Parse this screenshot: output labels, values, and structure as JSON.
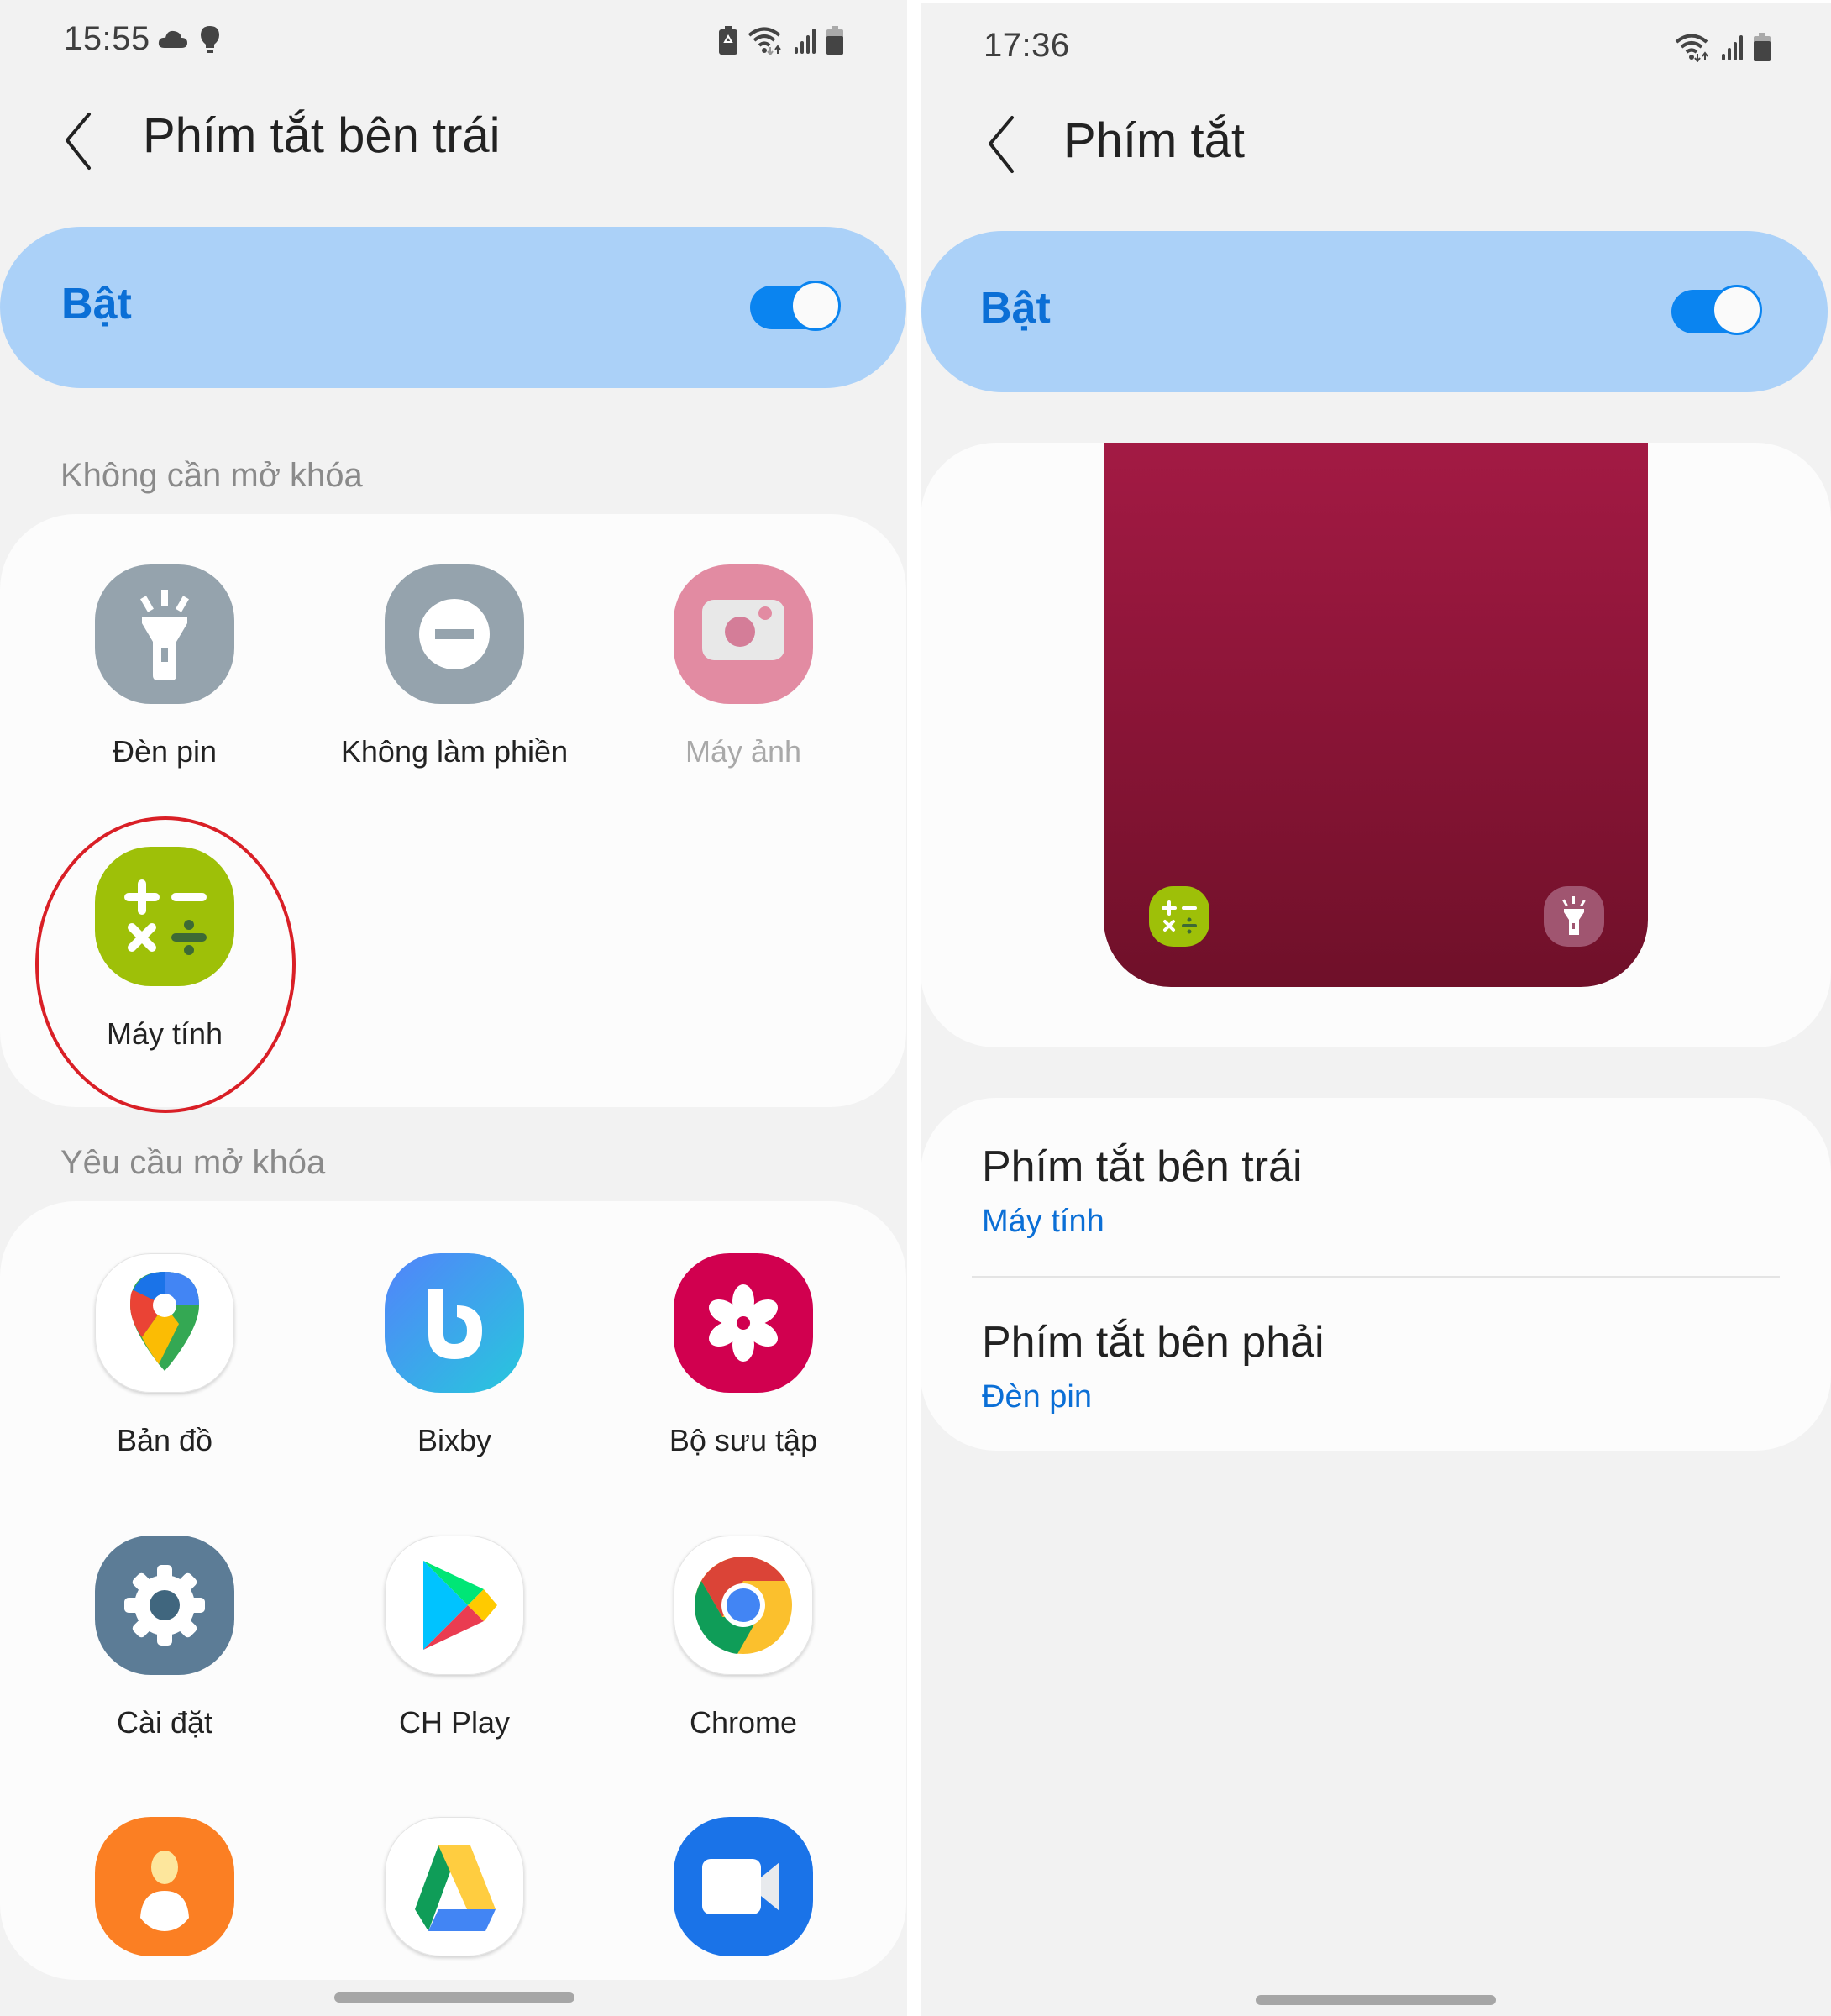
{
  "left_screen": {
    "status_bar": {
      "time": "15:55",
      "left_icons": [
        "cloud-icon",
        "lightbulb-icon"
      ],
      "right_icons": [
        "battery-saver-icon",
        "wifi-icon",
        "signal-icon",
        "battery-icon"
      ]
    },
    "header": {
      "back_icon": "back-arrow-icon",
      "title": "Phím tắt bên trái"
    },
    "master_switch": {
      "label": "Bật",
      "enabled": true
    },
    "sections": [
      {
        "label": "Không cần mở khóa",
        "apps": [
          {
            "name": "Đèn pin",
            "icon": "flashlight-icon",
            "color": "#95a3ad",
            "disabled": false
          },
          {
            "name": "Không làm phiền",
            "icon": "do-not-disturb-icon",
            "color": "#95a3ad",
            "disabled": false
          },
          {
            "name": "Máy ảnh",
            "icon": "camera-icon",
            "color": "#e28ba2",
            "disabled": true
          },
          {
            "name": "Máy tính",
            "icon": "calculator-icon",
            "color": "#9ec008",
            "disabled": false,
            "selected": true
          }
        ]
      },
      {
        "label": "Yêu cầu mở khóa",
        "apps": [
          {
            "name": "Bản đồ",
            "icon": "google-maps-icon"
          },
          {
            "name": "Bixby",
            "icon": "bixby-icon",
            "color": "#4a8cf5"
          },
          {
            "name": "Bộ sưu tập",
            "icon": "gallery-icon",
            "color": "#d1004f"
          },
          {
            "name": "Cài đặt",
            "icon": "settings-icon",
            "color": "#5c7c96"
          },
          {
            "name": "CH Play",
            "icon": "play-store-icon"
          },
          {
            "name": "Chrome",
            "icon": "chrome-icon"
          },
          {
            "name": "",
            "icon": "contacts-icon",
            "color": "#fb7f23"
          },
          {
            "name": "",
            "icon": "google-drive-icon"
          },
          {
            "name": "",
            "icon": "duo-video-icon",
            "color": "#1a73e8"
          }
        ]
      }
    ],
    "annotation": {
      "type": "red-ellipse",
      "target": "Máy tính",
      "color": "#d91f26"
    }
  },
  "right_screen": {
    "status_bar": {
      "time": "17:36",
      "right_icons": [
        "wifi-icon",
        "signal-icon",
        "battery-icon"
      ]
    },
    "header": {
      "back_icon": "back-arrow-icon",
      "title": "Phím tắt"
    },
    "master_switch": {
      "label": "Bật",
      "enabled": true
    },
    "preview": {
      "left_shortcut_icon": "calculator-icon",
      "right_shortcut_icon": "flashlight-icon",
      "wallpaper_colors": [
        "#a31a44",
        "#6f1029"
      ]
    },
    "shortcuts": [
      {
        "title": "Phím tắt bên trái",
        "value": "Máy tính"
      },
      {
        "title": "Phím tắt bên phải",
        "value": "Đèn pin"
      }
    ]
  },
  "colors": {
    "accent": "#0b6fd6",
    "switch_card": "#abd1f8",
    "toggle_on": "#0a84f0",
    "background": "#f2f2f2",
    "card": "#fcfcfc"
  }
}
